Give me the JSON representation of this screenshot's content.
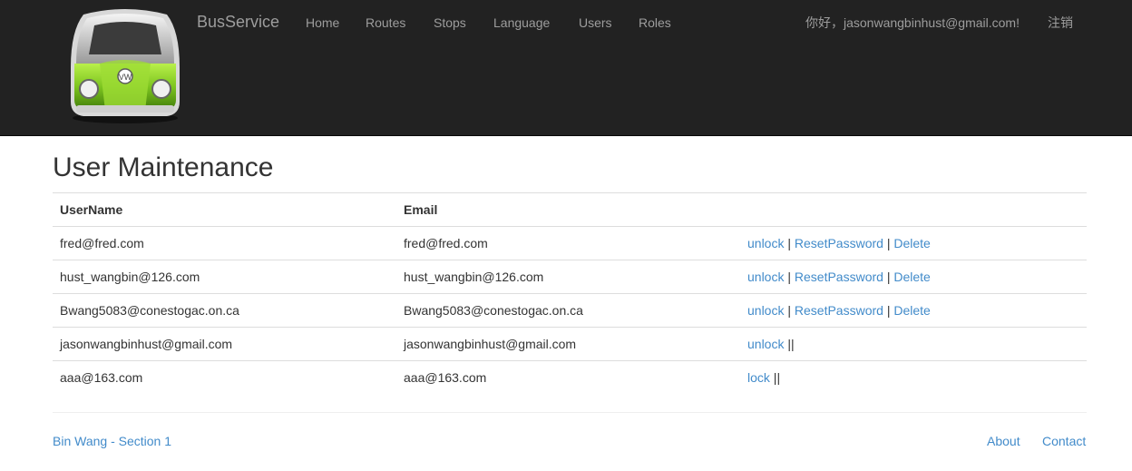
{
  "navbar": {
    "brand": "BusService",
    "links": [
      "Home",
      "Routes",
      "Stops",
      "Language",
      "Users",
      "Roles"
    ],
    "greeting": "你好，jasonwangbinhust@gmail.com!",
    "logout": "注销"
  },
  "page": {
    "title": "User Maintenance",
    "headers": [
      "UserName",
      "Email"
    ],
    "separator": "|",
    "rows": [
      {
        "username": "fred@fred.com",
        "email": "fred@fred.com",
        "lock": "unlock",
        "reset": "ResetPassword",
        "delete": "Delete"
      },
      {
        "username": "hust_wangbin@126.com",
        "email": "hust_wangbin@126.com",
        "lock": "unlock",
        "reset": "ResetPassword",
        "delete": "Delete"
      },
      {
        "username": "Bwang5083@conestogac.on.ca",
        "email": "Bwang5083@conestogac.on.ca",
        "lock": "unlock",
        "reset": "ResetPassword",
        "delete": "Delete"
      },
      {
        "username": "jasonwangbinhust@gmail.com",
        "email": "jasonwangbinhust@gmail.com",
        "lock": "unlock",
        "reset": "",
        "delete": ""
      },
      {
        "username": "aaa@163.com",
        "email": "aaa@163.com",
        "lock": "lock",
        "reset": "",
        "delete": ""
      }
    ]
  },
  "footer": {
    "left": "Bin Wang - Section 1",
    "about": "About",
    "contact": "Contact"
  },
  "colors": {
    "navbar_bg": "#222222",
    "nav_text": "#9d9d9d",
    "link": "#428bca",
    "bus_green": "#7cc41f"
  }
}
